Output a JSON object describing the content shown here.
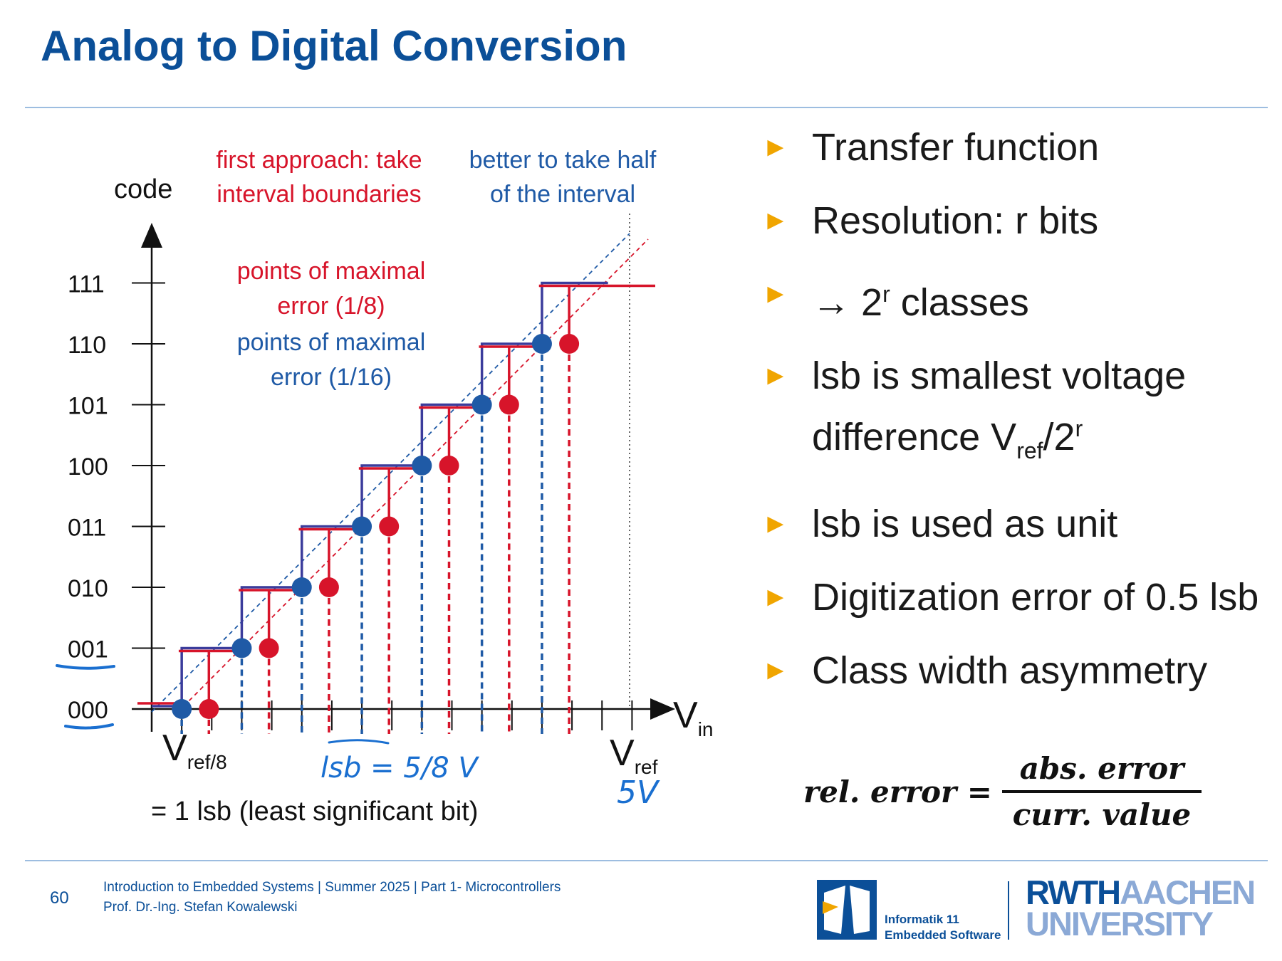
{
  "slide": {
    "title": "Analog to Digital Conversion",
    "page_number": "60",
    "footer_course": "Introduction to Embedded Systems | Summer 2025 | Part 1- Microcontrollers",
    "footer_author": "Prof. Dr.-Ing. Stefan Kowalewski"
  },
  "colors": {
    "title": "#0b4f98",
    "red": "#d7142a",
    "blue": "#1f5aa6",
    "purple": "#3b3c9c",
    "bullet": "#f0a500"
  },
  "diagram": {
    "y_axis_label": "code",
    "x_axis_label": "V",
    "x_axis_label_sub": "in",
    "codes": [
      "000",
      "001",
      "010",
      "011",
      "100",
      "101",
      "110",
      "111"
    ],
    "vref8_main": "V",
    "vref8_sub": "ref/8",
    "vref_main": "V",
    "vref_sub": "ref",
    "lsb_note": "= 1 lsb (least significant bit)",
    "red_note_line1": "first approach: take",
    "red_note_line2": "interval boundaries",
    "blue_note_line1": "better to take half",
    "blue_note_line2": "of the interval",
    "red_err_line1": "points of maximal",
    "red_err_line2": "error  (1/8)",
    "blue_err_line1": "points of maximal",
    "blue_err_line2": "error  (1/16)",
    "handwriting_lsb": "lsb = 5/8 V",
    "handwriting_5v": "5V"
  },
  "bullets": {
    "b1": "Transfer function",
    "b2": "Resolution: r bits",
    "b3_arrow": "→",
    "b3_base": "2",
    "b3_sup": "r",
    "b3_text": "classes",
    "b4_line1": "lsb is smallest voltage",
    "b4_line2a": "difference V",
    "b4_sub": "ref",
    "b4_line2b": "/2",
    "b4_sup": "r",
    "b5": "lsb is used as unit",
    "b6": "Digitization error of 0.5 lsb",
    "b7": "Class width asymmetry"
  },
  "formula": {
    "lhs": "rel. error =",
    "numerator": "abs. error",
    "denominator": "curr. value"
  },
  "logos": {
    "i11_line1": "Informatik 11",
    "i11_line2": "Embedded Software",
    "rwth_dark": "RWTH",
    "rwth_light": "AACHEN",
    "rwth_uni": "UNIVERSITY"
  }
}
